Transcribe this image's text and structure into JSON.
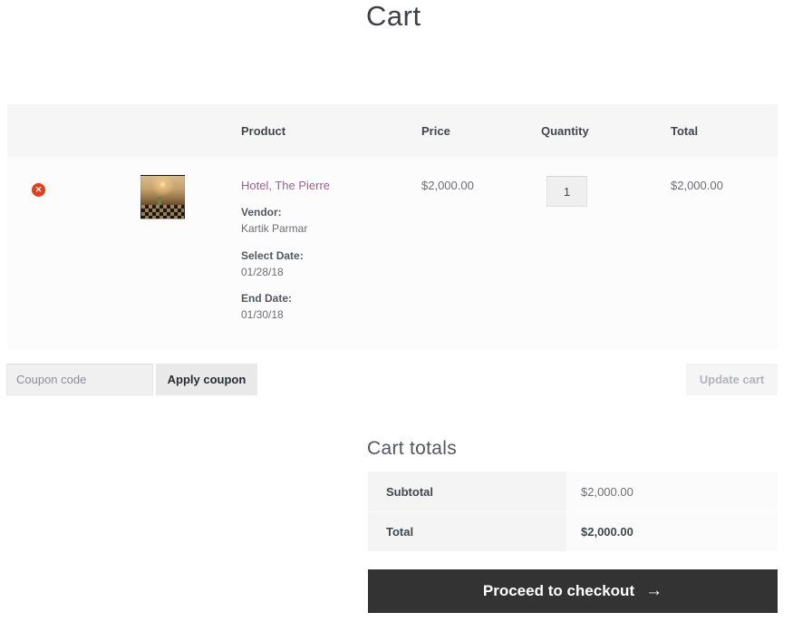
{
  "page": {
    "title": "Cart"
  },
  "icons": {
    "remove": "✕",
    "arrow_right": "→"
  },
  "cart_table": {
    "headers": {
      "product": "Product",
      "price": "Price",
      "quantity": "Quantity",
      "total": "Total"
    },
    "row": {
      "product_name": "Hotel, The Pierre",
      "vendor_label": "Vendor:",
      "vendor_value": "Kartik Parmar",
      "select_date_label": "Select Date:",
      "select_date_value": "01/28/18",
      "end_date_label": "End Date:",
      "end_date_value": "01/30/18",
      "price": "$2,000.00",
      "quantity": "1",
      "total": "$2,000.00"
    },
    "coupon": {
      "placeholder": "Coupon code",
      "apply_label": "Apply coupon",
      "update_cart_label": "Update cart"
    }
  },
  "cart_totals": {
    "heading": "Cart totals",
    "rows": [
      {
        "label": "Subtotal",
        "value": "$2,000.00"
      },
      {
        "label": "Total",
        "value": "$2,000.00"
      }
    ],
    "checkout_label": "Proceed to checkout"
  },
  "colors": {
    "accent_remove": "#e2401c",
    "link": "#9c6191",
    "checkout_bg": "#333333",
    "checkout_text": "#ffffff",
    "header_bg": "#f6f6f6",
    "row_bg": "#fcfcfc",
    "totals_th_bg": "#f4f4f4",
    "totals_td_bg": "#fbfbfb",
    "text_dark": "#43454b",
    "text_muted": "#6d6d77"
  }
}
